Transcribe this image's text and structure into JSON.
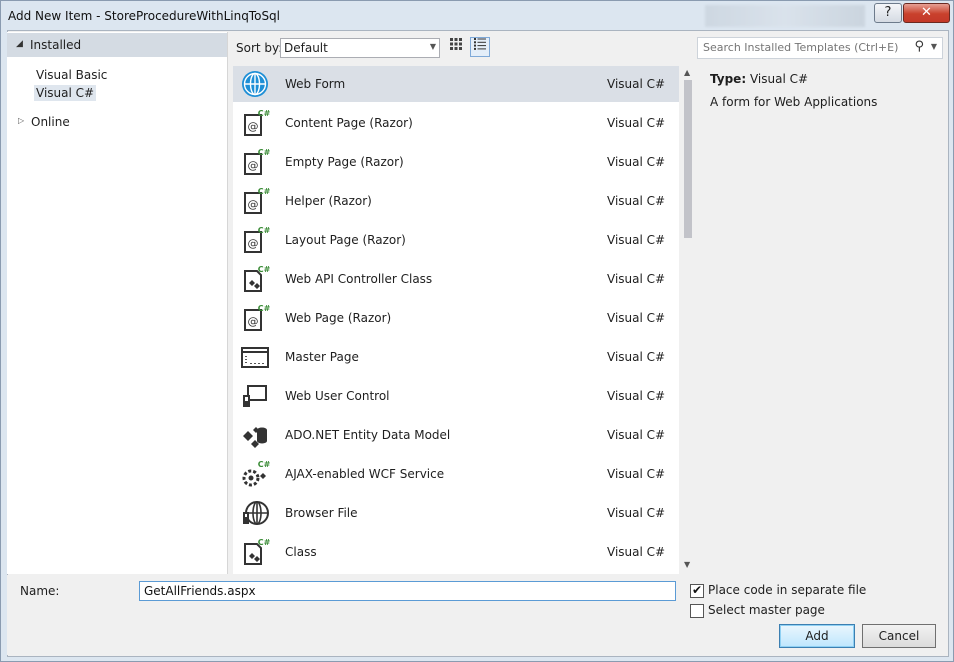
{
  "window": {
    "title": "Add New Item - StoreProcedureWithLinqToSql",
    "help_label": "?",
    "close_label": "✕"
  },
  "tree": {
    "header_label": "Installed",
    "items": [
      {
        "label": "Visual Basic"
      },
      {
        "label": "Visual C#"
      }
    ],
    "online_label": "Online"
  },
  "toolbar": {
    "sort_label": "Sort by:",
    "sort_value": "Default"
  },
  "search": {
    "placeholder": "Search Installed Templates (Ctrl+E)"
  },
  "templates": [
    {
      "name": "Web Form",
      "lang": "Visual C#",
      "icon": "globe-icon"
    },
    {
      "name": "Content Page (Razor)",
      "lang": "Visual C#",
      "icon": "razor-page-icon"
    },
    {
      "name": "Empty Page (Razor)",
      "lang": "Visual C#",
      "icon": "razor-page-icon"
    },
    {
      "name": "Helper (Razor)",
      "lang": "Visual C#",
      "icon": "razor-page-icon"
    },
    {
      "name": "Layout Page (Razor)",
      "lang": "Visual C#",
      "icon": "razor-page-icon"
    },
    {
      "name": "Web API Controller Class",
      "lang": "Visual C#",
      "icon": "class-file-icon"
    },
    {
      "name": "Web Page (Razor)",
      "lang": "Visual C#",
      "icon": "razor-page-icon"
    },
    {
      "name": "Master Page",
      "lang": "Visual C#",
      "icon": "master-page-icon"
    },
    {
      "name": "Web User Control",
      "lang": "Visual C#",
      "icon": "user-control-icon"
    },
    {
      "name": "ADO.NET Entity Data Model",
      "lang": "Visual C#",
      "icon": "entity-model-icon"
    },
    {
      "name": "AJAX-enabled WCF Service",
      "lang": "Visual C#",
      "icon": "wcf-service-icon"
    },
    {
      "name": "Browser File",
      "lang": "Visual C#",
      "icon": "browser-file-icon"
    },
    {
      "name": "Class",
      "lang": "Visual C#",
      "icon": "class-file-icon"
    }
  ],
  "detail": {
    "type_label": "Type:",
    "type_value": "Visual C#",
    "description": "A form for Web Applications"
  },
  "bottom": {
    "name_label": "Name:",
    "name_value": "GetAllFriends.aspx",
    "separate_file_label": "Place code in separate file",
    "separate_file_checked": true,
    "master_page_label": "Select master page",
    "master_page_checked": false,
    "add_label": "Add",
    "cancel_label": "Cancel"
  }
}
